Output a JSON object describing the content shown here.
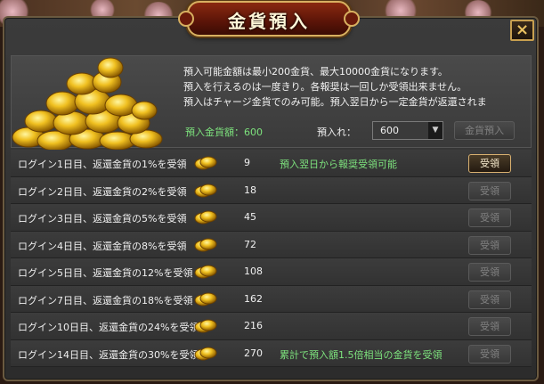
{
  "window": {
    "title": "金貨預入",
    "close_label": "×"
  },
  "notice": {
    "lines": [
      "預入可能金額は最小200金貨、最大10000金貨になります。",
      "預入を行えるのは一度きり。各報奨は一回しか受領出来ません。",
      "預入はチャージ金貨でのみ可能。預入翌日から一定金貨が返還されま"
    ]
  },
  "deposit": {
    "amount_text": "預入金貨額：600",
    "input_label": "預入れ：",
    "selected_value": "600",
    "submit_label": "金貨預入"
  },
  "rewards": [
    {
      "label": "ログイン1日目、返還金貨の1%を受領",
      "amount": "9",
      "note": "預入翌日から報奨受領可能",
      "button": "受領",
      "enabled": true
    },
    {
      "label": "ログイン2日目、返還金貨の2%を受領",
      "amount": "18",
      "note": "",
      "button": "受領",
      "enabled": false
    },
    {
      "label": "ログイン3日目、返還金貨の5%を受領",
      "amount": "45",
      "note": "",
      "button": "受領",
      "enabled": false
    },
    {
      "label": "ログイン4日目、返還金貨の8%を受領",
      "amount": "72",
      "note": "",
      "button": "受領",
      "enabled": false
    },
    {
      "label": "ログイン5日目、返還金貨の12%を受領",
      "amount": "108",
      "note": "",
      "button": "受領",
      "enabled": false
    },
    {
      "label": "ログイン7日目、返還金貨の18%を受領",
      "amount": "162",
      "note": "",
      "button": "受領",
      "enabled": false
    },
    {
      "label": "ログイン10日目、返還金貨の24%を受領",
      "amount": "216",
      "note": "",
      "button": "受領",
      "enabled": false
    },
    {
      "label": "ログイン14日目、返還金貨の30%を受領",
      "amount": "270",
      "note": "累計で預入額1.5倍相当の金貨を受領",
      "button": "受領",
      "enabled": false
    }
  ],
  "colors": {
    "accent_green": "#7de27d",
    "gold": "#d8b060",
    "panel_bg": "#333333"
  }
}
